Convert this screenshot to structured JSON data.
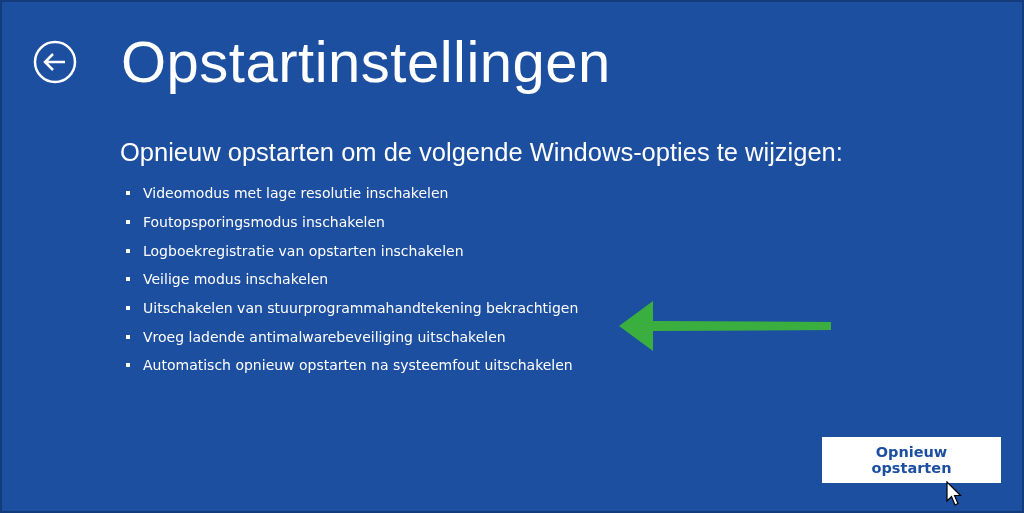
{
  "title": "Opstartinstellingen",
  "subtitle": "Opnieuw opstarten om de volgende Windows-opties te wijzigen:",
  "options": [
    {
      "label": "Videomodus met lage resolutie inschakelen"
    },
    {
      "label": "Foutopsporingsmodus inschakelen"
    },
    {
      "label": "Logboekregistratie van opstarten inschakelen"
    },
    {
      "label": "Veilige modus inschakelen"
    },
    {
      "label": "Uitschakelen van stuurprogrammahandtekening bekrachtigen"
    },
    {
      "label": "Vroeg ladende antimalwarebeveiliging uitschakelen"
    },
    {
      "label": "Automatisch opnieuw opstarten na systeemfout uitschakelen"
    }
  ],
  "restart_button": "Opnieuw opstarten"
}
